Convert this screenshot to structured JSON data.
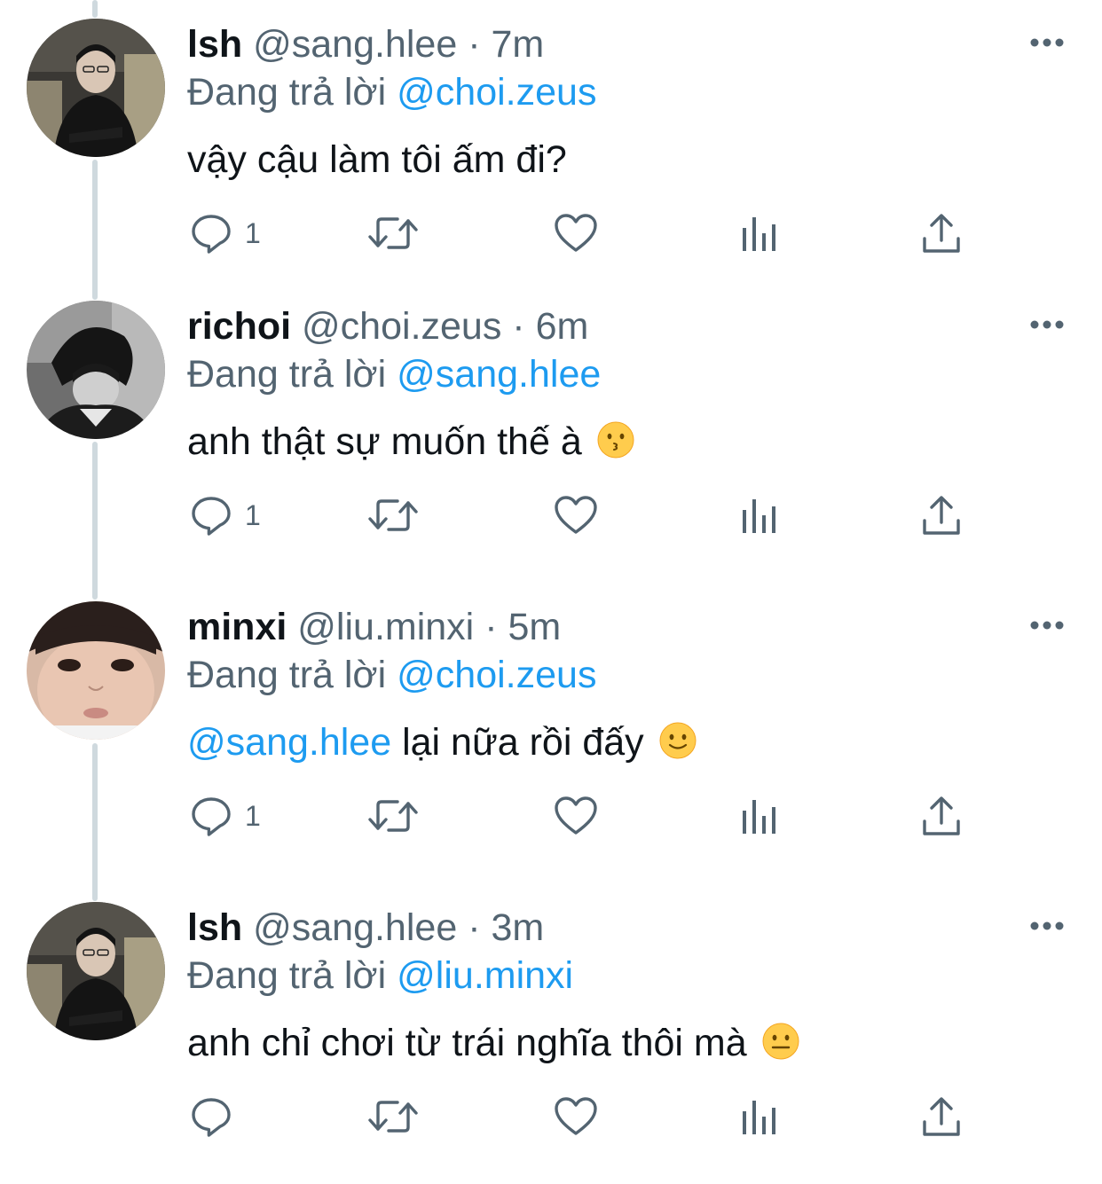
{
  "colors": {
    "text_primary": "#0f1419",
    "text_secondary": "#536471",
    "mention": "#1d9bf0",
    "thread_line": "#cfd9de"
  },
  "tweets": [
    {
      "display_name": "lsh",
      "handle": "@sang.hlee",
      "separator": "·",
      "time": "7m",
      "replying_prefix": "Đang trả lời",
      "replying_to": "@choi.zeus",
      "text_mention": "",
      "text": "vậy cậu làm tôi ấm đi?",
      "emoji": "",
      "reply_count": "1",
      "avatar_icon": "avatar-photo-lsh"
    },
    {
      "display_name": "richoi",
      "handle": "@choi.zeus",
      "separator": "·",
      "time": "6m",
      "replying_prefix": "Đang trả lời",
      "replying_to": "@sang.hlee",
      "text_mention": "",
      "text": "anh thật sự muốn thế à",
      "emoji": "kissing-face-emoji",
      "reply_count": "1",
      "avatar_icon": "avatar-photo-richoi"
    },
    {
      "display_name": "minxi",
      "handle": "@liu.minxi",
      "separator": "·",
      "time": "5m",
      "replying_prefix": "Đang trả lời",
      "replying_to": "@choi.zeus",
      "text_mention": "@sang.hlee",
      "text": " lại nữa rồi đấy",
      "emoji": "slightly-smiling-face-emoji",
      "reply_count": "1",
      "avatar_icon": "avatar-photo-minxi"
    },
    {
      "display_name": "lsh",
      "handle": "@sang.hlee",
      "separator": "·",
      "time": "3m",
      "replying_prefix": "Đang trả lời",
      "replying_to": "@liu.minxi",
      "text_mention": "",
      "text": "anh chỉ chơi từ trái nghĩa thôi mà",
      "emoji": "neutral-face-emoji",
      "reply_count": "",
      "avatar_icon": "avatar-photo-lsh"
    }
  ],
  "icons": {
    "more": "more-options-icon",
    "reply": "reply-bubble-icon",
    "retweet": "retweet-icon",
    "like": "heart-icon",
    "analytics": "analytics-bars-icon",
    "share": "share-icon"
  }
}
